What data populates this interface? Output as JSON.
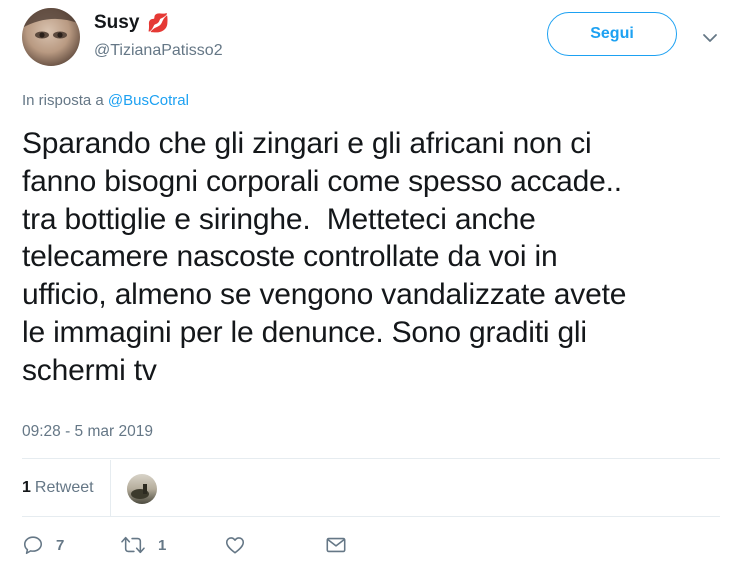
{
  "user": {
    "display_name": "Susy",
    "emoji": "💋",
    "handle": "@TizianaPatisso2"
  },
  "header": {
    "follow_label": "Segui"
  },
  "reply": {
    "prefix": "In risposta a ",
    "mention": "@BusCotral"
  },
  "tweet": {
    "text": "Sparando che gli zingari e gli africani non ci\nfanno bisogni corporali come spesso accade..\ntra bottiglie e siringhe.  Metteteci anche\ntelecamere nascoste controllate da voi in\nufficio, almeno se vengono vandalizzate avete\nle immagini per le denunce. Sono graditi gli\nschermi tv",
    "timestamp": "09:28 - 5 mar 2019"
  },
  "stats": {
    "retweet_count": "1",
    "retweet_label": "Retweet"
  },
  "actions": {
    "reply_count": "7",
    "retweet_count": "1",
    "like_count": "",
    "icons": [
      "reply-icon",
      "retweet-icon",
      "like-icon",
      "direct-message-icon"
    ]
  },
  "colors": {
    "accent": "#1da1f2",
    "secondary_text": "#657786",
    "primary_text": "#14171a",
    "divider": "#e6ecf0"
  }
}
